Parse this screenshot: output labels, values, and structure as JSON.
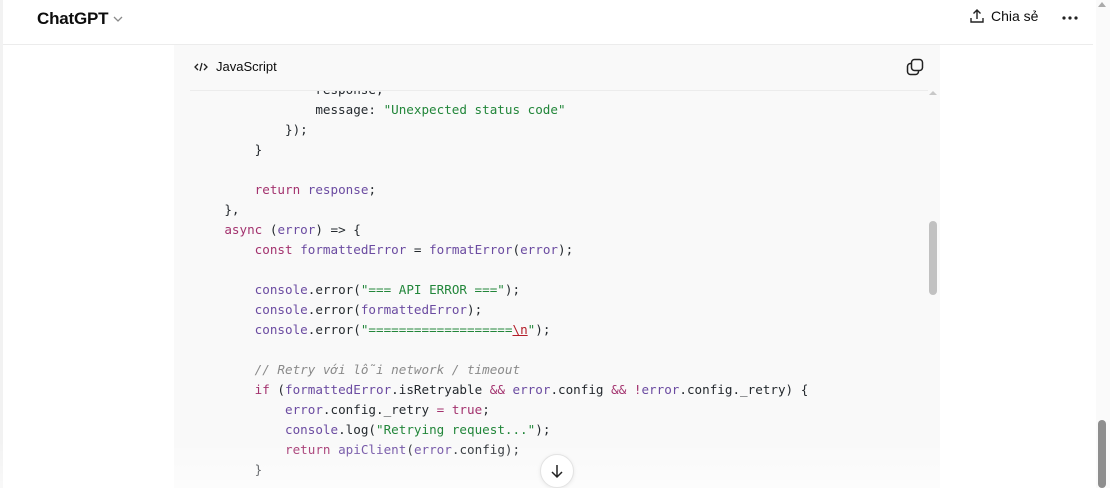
{
  "header": {
    "title": "ChatGPT",
    "share_label": "Chia sẻ"
  },
  "code_block": {
    "language": "JavaScript",
    "lines": [
      [
        [
          "p",
          "                response,"
        ]
      ],
      [
        [
          "p",
          "                message: "
        ],
        [
          "s",
          "\"Unexpected status code\""
        ]
      ],
      [
        [
          "p",
          "            });"
        ]
      ],
      [
        [
          "p",
          "        }"
        ]
      ],
      [],
      [
        [
          "p",
          "        "
        ],
        [
          "k",
          "return"
        ],
        [
          "p",
          " "
        ],
        [
          "v",
          "response"
        ],
        [
          "p",
          ";"
        ]
      ],
      [
        [
          "p",
          "    },"
        ]
      ],
      [
        [
          "p",
          "    "
        ],
        [
          "k",
          "async"
        ],
        [
          "p",
          " ("
        ],
        [
          "v",
          "error"
        ],
        [
          "p",
          ") => {"
        ]
      ],
      [
        [
          "p",
          "        "
        ],
        [
          "k",
          "const"
        ],
        [
          "p",
          " "
        ],
        [
          "v",
          "formattedError"
        ],
        [
          "p",
          " = "
        ],
        [
          "v",
          "formatError"
        ],
        [
          "p",
          "("
        ],
        [
          "v",
          "error"
        ],
        [
          "p",
          ");"
        ]
      ],
      [],
      [
        [
          "p",
          "        "
        ],
        [
          "v",
          "console"
        ],
        [
          "p",
          ".error("
        ],
        [
          "s",
          "\"=== API ERROR ===\""
        ],
        [
          "p",
          ");"
        ]
      ],
      [
        [
          "p",
          "        "
        ],
        [
          "v",
          "console"
        ],
        [
          "p",
          ".error("
        ],
        [
          "v",
          "formattedError"
        ],
        [
          "p",
          ");"
        ]
      ],
      [
        [
          "p",
          "        "
        ],
        [
          "v",
          "console"
        ],
        [
          "p",
          ".error("
        ],
        [
          "s",
          "\"==================="
        ],
        [
          "e",
          "\\n"
        ],
        [
          "s",
          "\""
        ],
        [
          "p",
          ");"
        ]
      ],
      [],
      [
        [
          "p",
          "        "
        ],
        [
          "c",
          "// Retry với lỗi network / timeout"
        ]
      ],
      [
        [
          "p",
          "        "
        ],
        [
          "k",
          "if"
        ],
        [
          "p",
          " ("
        ],
        [
          "v",
          "formattedError"
        ],
        [
          "p",
          ".isRetryable "
        ],
        [
          "k",
          "&&"
        ],
        [
          "p",
          " "
        ],
        [
          "v",
          "error"
        ],
        [
          "p",
          ".config "
        ],
        [
          "k",
          "&&"
        ],
        [
          "p",
          " "
        ],
        [
          "k",
          "!"
        ],
        [
          "v",
          "error"
        ],
        [
          "p",
          ".config._retry) {"
        ]
      ],
      [
        [
          "p",
          "            "
        ],
        [
          "v",
          "error"
        ],
        [
          "p",
          ".config._retry "
        ],
        [
          "k",
          "="
        ],
        [
          "p",
          " "
        ],
        [
          "k",
          "true"
        ],
        [
          "p",
          ";"
        ]
      ],
      [
        [
          "p",
          "            "
        ],
        [
          "v",
          "console"
        ],
        [
          "p",
          ".log("
        ],
        [
          "s",
          "\"Retrying request...\""
        ],
        [
          "p",
          ");"
        ]
      ],
      [
        [
          "p",
          "            "
        ],
        [
          "k",
          "return"
        ],
        [
          "p",
          " "
        ],
        [
          "v",
          "apiClient"
        ],
        [
          "p",
          "("
        ],
        [
          "v",
          "error"
        ],
        [
          "p",
          ".config);"
        ]
      ],
      [
        [
          "p",
          "        }"
        ]
      ]
    ]
  }
}
